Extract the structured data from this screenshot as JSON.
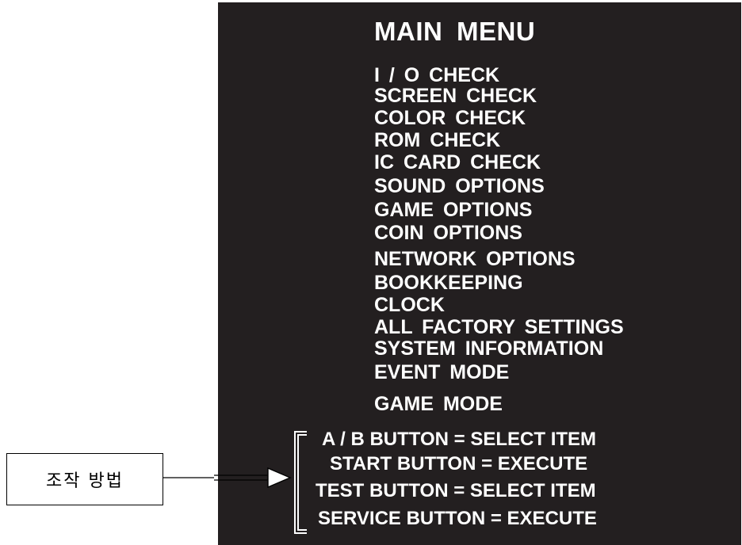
{
  "screen": {
    "title": "MAIN  MENU",
    "menu_items": [
      "I / O  CHECK",
      "SCREEN  CHECK",
      "COLOR  CHECK",
      "ROM  CHECK",
      "IC  CARD  CHECK",
      "SOUND  OPTIONS",
      "GAME  OPTIONS",
      "COIN  OPTIONS",
      "NETWORK  OPTIONS",
      "BOOKKEEPING",
      "CLOCK",
      "ALL  FACTORY  SETTINGS",
      "SYSTEM  INFORMATION",
      "EVENT MODE",
      "GAME MODE"
    ],
    "controls": [
      "A / B BUTTON = SELECT ITEM",
      "START BUTTON = EXECUTE",
      "TEST BUTTON = SELECT ITEM",
      "SERVICE BUTTON = EXECUTE"
    ]
  },
  "callout": {
    "label": "조작 방법"
  },
  "colors": {
    "screen_background": "#231f20",
    "screen_text": "#ffffff",
    "page_background": "#ffffff"
  }
}
